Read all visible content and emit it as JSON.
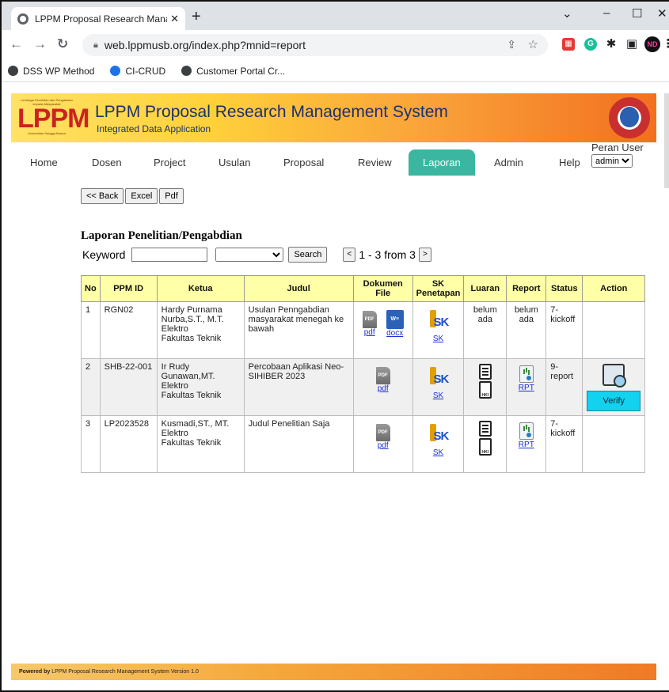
{
  "browser": {
    "tab_title": "LPPM Proposal Research Manage",
    "tab_close": "✕",
    "new_tab": "+",
    "url": "web.lppmusb.org/index.php?mnid=report",
    "bookmarks": [
      "DSS WP Method",
      "CI-CRUD",
      "Customer Portal Cr..."
    ],
    "ext_profile": "ND"
  },
  "banner": {
    "logo_text": "LPPM",
    "logo_top": "Lembaga Penelitian dan Pengabdian kepada Masyarakat",
    "logo_bottom": "Universitas Sangga Buana",
    "title": "LPPM Proposal Research Management System",
    "subtitle": "Integrated Data Application"
  },
  "menu": {
    "items": [
      "Home",
      "Dosen",
      "Project",
      "Usulan",
      "Proposal",
      "Review",
      "Laporan",
      "Admin",
      "Help"
    ],
    "active": "Laporan",
    "role_label": "Peran User",
    "role_value": "admin"
  },
  "toolbar": {
    "back": "<< Back",
    "excel": "Excel",
    "pdf": "Pdf"
  },
  "report": {
    "title": "Laporan Penelitian/Pengabdian",
    "keyword_label": "Keyword",
    "keyword_value": "",
    "filter_value": "",
    "search_label": "Search",
    "pager_prev": "<",
    "pager_text": "1 - 3 from 3",
    "pager_next": ">"
  },
  "table": {
    "headers": [
      "No",
      "PPM ID",
      "Ketua",
      "Judul",
      "Dokumen File",
      "SK Penetapan",
      "Luaran",
      "Report",
      "Status",
      "Action"
    ],
    "rows": [
      {
        "no": "1",
        "id": "RGN02",
        "ketua": [
          "Hardy Purnama Nurba,S.T., M.T.",
          "Elektro",
          "Fakultas Teknik"
        ],
        "judul": "Usulan Penngabdian masyarakat menegah ke bawah",
        "docs": [
          "pdf",
          "docx"
        ],
        "sk": "SK",
        "luaran": "belum ada",
        "report": "belum ada",
        "status": "7-kickoff",
        "action": ""
      },
      {
        "no": "2",
        "id": "SHB-22-001",
        "ketua": [
          "Ir Rudy Gunawan,MT.",
          "Elektro",
          "Fakultas Teknik"
        ],
        "judul": "Percobaan Aplikasi Neo-SIHIBER 2023",
        "docs": [
          "pdf"
        ],
        "sk": "SK",
        "luaran": "",
        "report": "RPT",
        "status": "9-report",
        "action": "Verify"
      },
      {
        "no": "3",
        "id": "LP2023528",
        "ketua": [
          "Kusmadi,ST., MT.",
          "Elektro",
          "Fakultas Teknik"
        ],
        "judul": "Judul Penelitian Saja",
        "docs": [
          "pdf"
        ],
        "sk": "SK",
        "luaran": "",
        "report": "RPT",
        "status": "7-kickoff",
        "action": ""
      }
    ]
  },
  "footer": {
    "powered": "Powered by",
    "text": "LPPM Proposal Research Management System Version 1.0"
  },
  "colors": {
    "active_tab": "#3bb6a0",
    "header_row": "#ffffa8",
    "verify_button": "#12d2f0",
    "banner_title": "#1d2f6b"
  }
}
